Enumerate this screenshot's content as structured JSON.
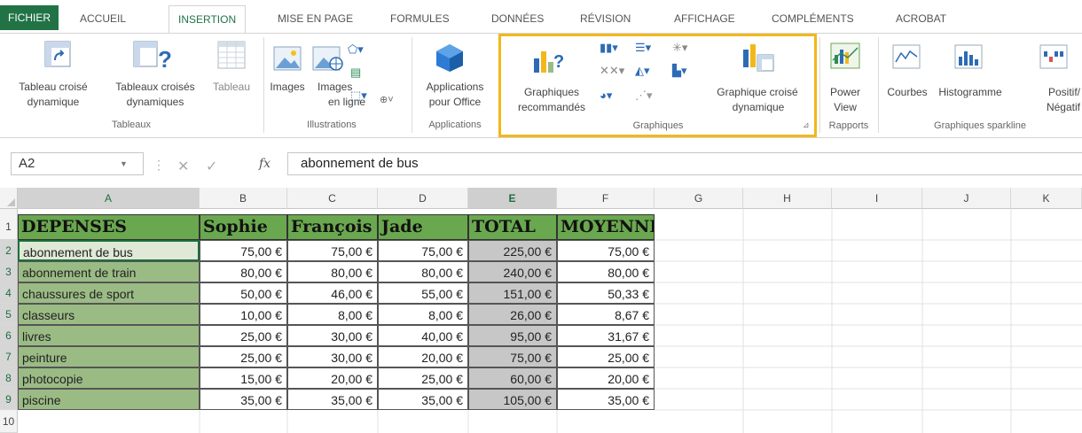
{
  "tabs": [
    {
      "label": "FICHIER"
    },
    {
      "label": "ACCUEIL"
    },
    {
      "label": "INSERTION"
    },
    {
      "label": "MISE EN PAGE"
    },
    {
      "label": "FORMULES"
    },
    {
      "label": "DONNÉES"
    },
    {
      "label": "RÉVISION"
    },
    {
      "label": "AFFICHAGE"
    },
    {
      "label": "COMPLÉMENTS"
    },
    {
      "label": "ACROBAT"
    }
  ],
  "ribbon": {
    "tableaux": {
      "tcd_l1": "Tableau croisé",
      "tcd_l2": "dynamique",
      "tcdr_l1": "Tableaux croisés",
      "tcdr_l2": "dynamiques",
      "tableau": "Tableau",
      "group": "Tableaux"
    },
    "illustrations": {
      "images": "Images",
      "images_online_l1": "Images",
      "images_online_l2": "en ligne",
      "group": "Illustrations"
    },
    "applications": {
      "apps_l1": "Applications",
      "apps_l2": "pour Office",
      "group": "Applications"
    },
    "graphiques": {
      "reco_l1": "Graphiques",
      "reco_l2": "recommandés",
      "gcd_l1": "Graphique croisé",
      "gcd_l2": "dynamique",
      "group": "Graphiques"
    },
    "rapports": {
      "power_l1": "Power",
      "power_l2": "View",
      "group": "Rapports"
    },
    "sparkline": {
      "courbes": "Courbes",
      "histogramme": "Histogramme",
      "positif_l1": "Positif/",
      "positif_l2": "Négatif",
      "group": "Graphiques sparkline"
    }
  },
  "formula_bar": {
    "namebox": "A2",
    "fx": "fx",
    "formula": "abonnement de bus"
  },
  "columns": [
    "A",
    "B",
    "C",
    "D",
    "E",
    "F",
    "G",
    "H",
    "I",
    "J",
    "K"
  ],
  "rows": [
    "1",
    "2",
    "3",
    "4",
    "5",
    "6",
    "7",
    "8",
    "9",
    "10"
  ],
  "table": {
    "headers": [
      "DEPENSES",
      "Sophie",
      "François",
      "Jade",
      "TOTAL",
      "MOYENNE"
    ],
    "rows": [
      [
        "abonnement de bus",
        "75,00 €",
        "75,00 €",
        "75,00 €",
        "225,00 €",
        "75,00 €"
      ],
      [
        "abonnement de train",
        "80,00 €",
        "80,00 €",
        "80,00 €",
        "240,00 €",
        "80,00 €"
      ],
      [
        "chaussures de sport",
        "50,00 €",
        "46,00 €",
        "55,00 €",
        "151,00 €",
        "50,33 €"
      ],
      [
        "classeurs",
        "10,00 €",
        "8,00 €",
        "8,00 €",
        "26,00 €",
        "8,67 €"
      ],
      [
        "livres",
        "25,00 €",
        "30,00 €",
        "40,00 €",
        "95,00 €",
        "31,67 €"
      ],
      [
        "peinture",
        "25,00 €",
        "30,00 €",
        "20,00 €",
        "75,00 €",
        "25,00 €"
      ],
      [
        "photocopie",
        "15,00 €",
        "20,00 €",
        "25,00 €",
        "60,00 €",
        "20,00 €"
      ],
      [
        "piscine",
        "35,00 €",
        "35,00 €",
        "35,00 €",
        "105,00 €",
        "35,00 €"
      ]
    ]
  },
  "colors": {
    "excel_green": "#217346",
    "header_fill": "#6aa84f",
    "col_a_fill": "#9bbb85",
    "total_fill": "#c7c7c7",
    "highlight": "#f2b81b"
  }
}
